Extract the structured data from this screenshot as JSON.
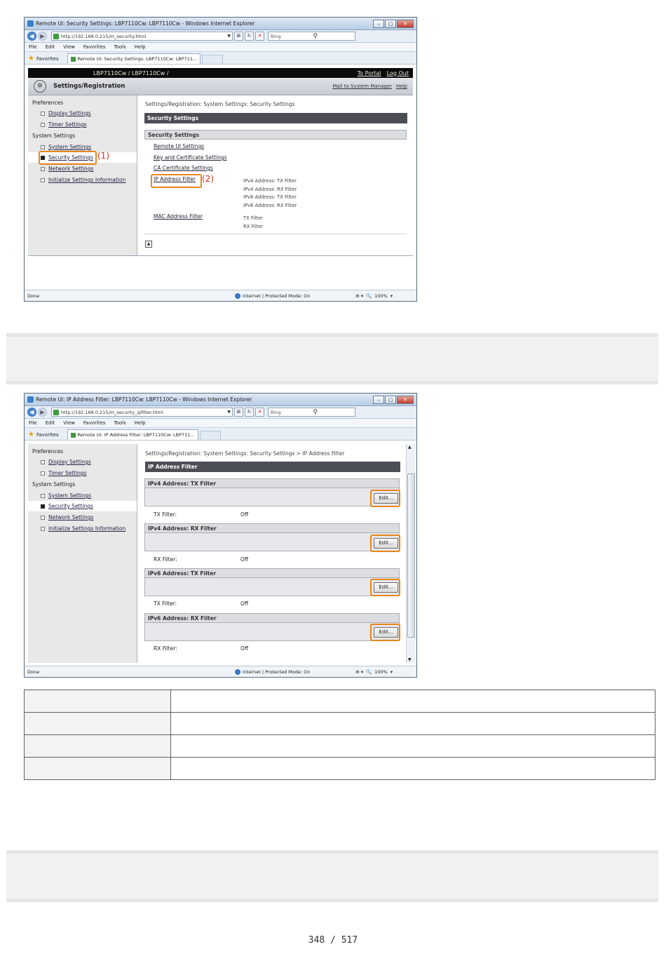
{
  "shot1": {
    "window_title": "Remote UI: Security Settings: LBP7110Cw: LBP7110Cw - Windows Internet Explorer",
    "url": "http://192.168.0.215/m_security.html",
    "search_placeholder": "Bing",
    "menu": [
      "File",
      "Edit",
      "View",
      "Favorites",
      "Tools",
      "Help"
    ],
    "favorites_label": "Favorites",
    "tab_title": "Remote UI: Security Settings: LBP7110Cw: LBP711...",
    "header_model": "LBP7110Cw / LBP7110Cw /",
    "to_portal": "To Portal",
    "log_out": "Log Out",
    "settings_title": "Settings/Registration",
    "mail_link": "Mail to System Manager",
    "help_link": "Help",
    "sidebar": {
      "preferences": "Preferences",
      "display_settings": "Display Settings",
      "timer_settings": "Timer Settings",
      "system_settings_group": "System Settings",
      "system_settings": "System Settings",
      "security_settings": "Security Settings",
      "network_settings": "Network Settings",
      "initialize": "Initialize Settings Information"
    },
    "breadcrumb": "Settings/Registration: System Settings: Security Settings",
    "page_heading": "Security Settings",
    "section_heading": "Security Settings",
    "links": {
      "remote_ui": "Remote UI Settings",
      "key_cert": "Key and Certificate Settings",
      "ca_cert": "CA Certificate Settings",
      "ip_filter": "IP Address Filter",
      "mac_filter": "MAC Address Filter"
    },
    "ip_desc": [
      "IPv4 Address: TX Filter",
      "IPv4 Address: RX Filter",
      "IPv6 Address: TX Filter",
      "IPv6 Address: RX Filter"
    ],
    "mac_desc": [
      "TX Filter",
      "RX Filter"
    ],
    "callout1": "(1)",
    "callout2": "(2)",
    "status_done": "Done",
    "status_zone": "Internet | Protected Mode: On",
    "status_zoom": "100%"
  },
  "shot2": {
    "window_title": "Remote UI: IP Address Filter: LBP7110Cw: LBP7110Cw - Windows Internet Explorer",
    "url": "http://192.168.0.215/m_security_ipfilter.html",
    "search_placeholder": "Bing",
    "menu": [
      "File",
      "Edit",
      "View",
      "Favorites",
      "Tools",
      "Help"
    ],
    "favorites_label": "Favorites",
    "tab_title": "Remote UI: IP Address Filter: LBP7110Cw: LBP711...",
    "sidebar": {
      "preferences": "Preferences",
      "display_settings": "Display Settings",
      "timer_settings": "Timer Settings",
      "system_settings_group": "System Settings",
      "system_settings": "System Settings",
      "security_settings": "Security Settings",
      "network_settings": "Network Settings",
      "initialize": "Initialize Settings Information"
    },
    "breadcrumb": "Settings/Registration: System Settings: Security Settings > IP Address Filter",
    "page_heading": "IP Address Filter",
    "sections": [
      {
        "title": "IPv4 Address: TX Filter",
        "label": "TX Filter:",
        "value": "Off",
        "button": "Edit..."
      },
      {
        "title": "IPv4 Address: RX Filter",
        "label": "RX Filter:",
        "value": "Off",
        "button": "Edit..."
      },
      {
        "title": "IPv6 Address: TX Filter",
        "label": "TX Filter:",
        "value": "Off",
        "button": "Edit..."
      },
      {
        "title": "IPv6 Address: RX Filter",
        "label": "RX Filter:",
        "value": "Off",
        "button": "Edit..."
      }
    ],
    "status_done": "Done",
    "status_zone": "Internet | Protected Mode: On",
    "status_zoom": "100%"
  },
  "page_number": "348 / 517"
}
